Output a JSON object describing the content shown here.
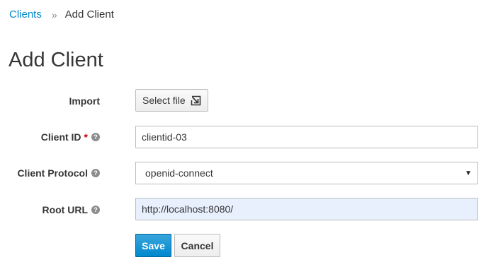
{
  "breadcrumb": {
    "parent": "Clients",
    "separator": "»",
    "current": "Add Client"
  },
  "title": "Add Client",
  "form": {
    "import": {
      "label": "Import",
      "button_label": "Select file",
      "icon": "import-file-icon"
    },
    "client_id": {
      "label": "Client ID",
      "required_marker": "*",
      "help_icon": "?",
      "value": "clientid-03"
    },
    "client_protocol": {
      "label": "Client Protocol",
      "help_icon": "?",
      "selected": "openid-connect",
      "caret": "▼"
    },
    "root_url": {
      "label": "Root URL",
      "help_icon": "?",
      "value": "http://localhost:8080/"
    }
  },
  "actions": {
    "save_label": "Save",
    "cancel_label": "Cancel"
  },
  "colors": {
    "link": "#0088ce",
    "primary": "#0088ce",
    "required": "#cc0000",
    "autofill_bg": "#e8f0fe"
  }
}
